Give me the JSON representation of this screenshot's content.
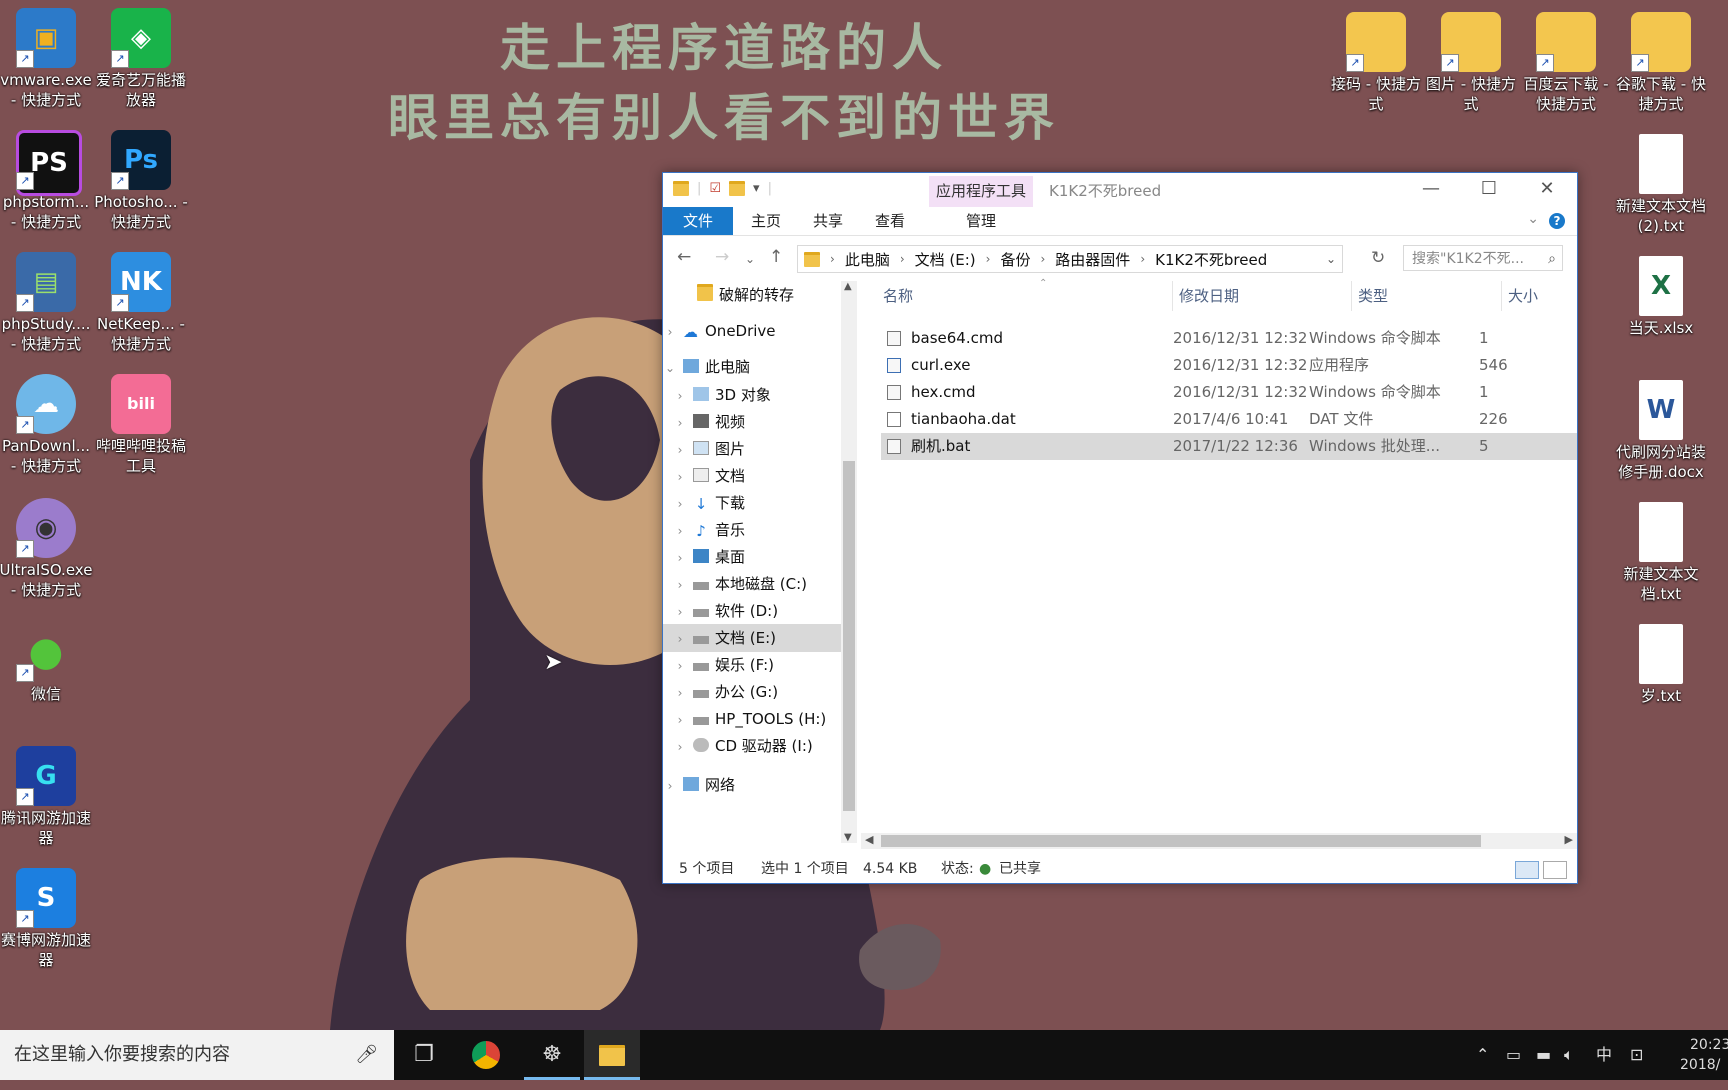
{
  "wallpaper": {
    "line1": "走上程序道路的人",
    "line2": "眼里总有别人看不到的世界"
  },
  "desktop_left": [
    {
      "label": "vmware.exe - 快捷方式",
      "icon": "vmware-icon"
    },
    {
      "label": "爱奇艺万能播放器",
      "icon": "iqiyi-icon"
    },
    {
      "label": "phpstorm... - 快捷方式",
      "icon": "phpstorm-icon"
    },
    {
      "label": "Photosho... - 快捷方式",
      "icon": "photoshop-icon"
    },
    {
      "label": "phpStudy.... - 快捷方式",
      "icon": "phpstudy-icon"
    },
    {
      "label": "NetKeep... - 快捷方式",
      "icon": "netkeeper-icon"
    },
    {
      "label": "PanDownl... - 快捷方式",
      "icon": "pandownload-icon"
    },
    {
      "label": "哔哩哔哩投稿工具",
      "icon": "bilibili-icon"
    },
    {
      "label": "UltraISO.exe - 快捷方式",
      "icon": "ultraiso-icon"
    },
    {
      "label": "微信",
      "icon": "wechat-icon"
    },
    {
      "label": "腾讯网游加速器",
      "icon": "tencent-accelerator-icon"
    },
    {
      "label": "赛博网游加速器",
      "icon": "cyber-accelerator-icon"
    }
  ],
  "desktop_right": [
    {
      "label": "接码 - 快捷方式",
      "icon": "folder-icon"
    },
    {
      "label": "图片 - 快捷方式",
      "icon": "folder-icon"
    },
    {
      "label": "百度云下载 - 快捷方式",
      "icon": "folder-icon"
    },
    {
      "label": "谷歌下载 - 快捷方式",
      "icon": "folder-icon"
    },
    {
      "label": "新建文本文档 (2).txt",
      "icon": "text-file-icon"
    },
    {
      "label": "当天.xlsx",
      "icon": "excel-file-icon"
    },
    {
      "label": "代刷网分站装修手册.docx",
      "icon": "word-file-icon"
    },
    {
      "label": "新建文本文档.txt",
      "icon": "text-file-icon"
    },
    {
      "label": "岁.txt",
      "icon": "text-file-icon"
    }
  ],
  "explorer": {
    "context_tab": "应用程序工具",
    "title": "K1K2不死breed",
    "ribbon_tabs": [
      "文件",
      "主页",
      "共享",
      "查看",
      "管理"
    ],
    "breadcrumb": [
      "此电脑",
      "文档 (E:)",
      "备份",
      "路由器固件",
      "K1K2不死breed"
    ],
    "search_placeholder": "搜索\"K1K2不死...",
    "nav": [
      {
        "label": "破解的转存",
        "icon": "folder-icon",
        "expand": ""
      },
      {
        "label": "OneDrive",
        "icon": "onedrive-icon",
        "expand": "›"
      },
      {
        "label": "此电脑",
        "icon": "computer-icon",
        "expand": "⌄"
      },
      {
        "label": "3D 对象",
        "icon": "objects3d-icon",
        "expand": "›"
      },
      {
        "label": "视频",
        "icon": "video-icon",
        "expand": "›"
      },
      {
        "label": "图片",
        "icon": "pictures-icon",
        "expand": "›"
      },
      {
        "label": "文档",
        "icon": "documents-icon",
        "expand": "›"
      },
      {
        "label": "下载",
        "icon": "download-icon",
        "expand": "›"
      },
      {
        "label": "音乐",
        "icon": "music-icon",
        "expand": "›"
      },
      {
        "label": "桌面",
        "icon": "desktop-icon",
        "expand": "›"
      },
      {
        "label": "本地磁盘 (C:)",
        "icon": "drive-icon",
        "expand": "›"
      },
      {
        "label": "软件 (D:)",
        "icon": "drive-icon",
        "expand": "›"
      },
      {
        "label": "文档 (E:)",
        "icon": "drive-icon",
        "expand": "›"
      },
      {
        "label": "娱乐 (F:)",
        "icon": "drive-icon",
        "expand": "›"
      },
      {
        "label": "办公 (G:)",
        "icon": "drive-icon",
        "expand": "›"
      },
      {
        "label": "HP_TOOLS (H:)",
        "icon": "drive-icon",
        "expand": "›"
      },
      {
        "label": "CD 驱动器 (I:)",
        "icon": "cd-drive-icon",
        "expand": "›"
      },
      {
        "label": "网络",
        "icon": "network-icon",
        "expand": "›"
      }
    ],
    "columns": [
      "名称",
      "修改日期",
      "类型",
      "大小"
    ],
    "files": [
      {
        "name": "base64.cmd",
        "date": "2016/12/31 12:32",
        "type": "Windows 命令脚本",
        "size": "1",
        "icon": "cmd-file-icon"
      },
      {
        "name": "curl.exe",
        "date": "2016/12/31 12:32",
        "type": "应用程序",
        "size": "546",
        "icon": "exe-file-icon"
      },
      {
        "name": "hex.cmd",
        "date": "2016/12/31 12:32",
        "type": "Windows 命令脚本",
        "size": "1",
        "icon": "cmd-file-icon"
      },
      {
        "name": "tianbaoha.dat",
        "date": "2017/4/6 10:41",
        "type": "DAT 文件",
        "size": "226",
        "icon": "dat-file-icon"
      },
      {
        "name": "刷机.bat",
        "date": "2017/1/22 12:36",
        "type": "Windows 批处理...",
        "size": "5",
        "icon": "bat-file-icon"
      }
    ],
    "status": {
      "count": "5 个项目",
      "selected": "选中 1 个项目",
      "selected_size": "4.54 KB",
      "state_label": "状态:",
      "state_value": "已共享"
    }
  },
  "taskbar": {
    "search_placeholder": "在这里输入你要搜索的内容",
    "ime": "中",
    "time": "20:23",
    "date": "2018/"
  }
}
